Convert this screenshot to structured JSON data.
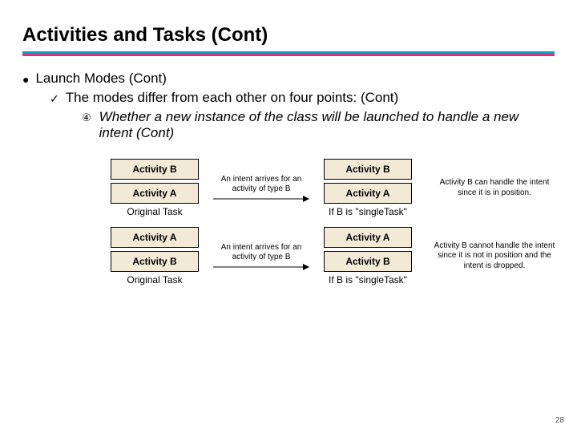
{
  "title": "Activities and Tasks (Cont)",
  "bullets": {
    "l1": "Launch Modes (Cont)",
    "l2": "The modes differ from each other on four points: (Cont)",
    "l3_marker": "④",
    "l3": "Whether a new instance of the class will be launched to handle a new intent (Cont)"
  },
  "row1": {
    "left_top": "Activity B",
    "left_bottom": "Activity A",
    "left_caption": "Original Task",
    "arrow_label": "An intent arrives for an activity of type B",
    "right_top": "Activity B",
    "right_bottom": "Activity A",
    "right_caption": "If B is \"singleTask\"",
    "note": "Activity B can handle the intent since it is in position."
  },
  "row2": {
    "left_top": "Activity A",
    "left_bottom": "Activity B",
    "left_caption": "Original Task",
    "arrow_label": "An intent arrives for an activity of type B",
    "right_top": "Activity A",
    "right_bottom": "Activity B",
    "right_caption": "If B is \"singleTask\"",
    "note": "Activity B cannot handle the intent since it is not in position and the intent is dropped."
  },
  "page_number": "28"
}
